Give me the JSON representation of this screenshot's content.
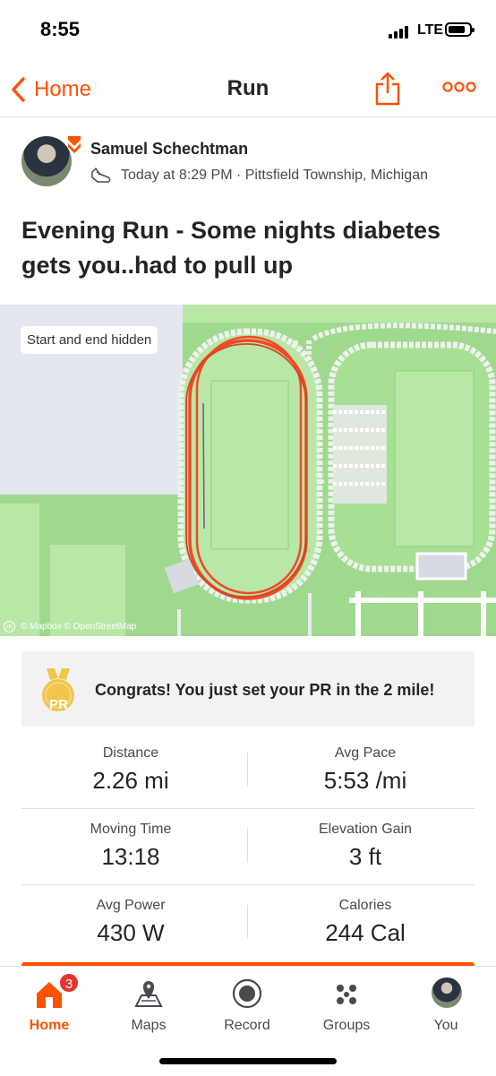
{
  "status_bar": {
    "time": "8:55",
    "network": "LTE"
  },
  "nav": {
    "back_label": "Home",
    "title": "Run"
  },
  "activity": {
    "athlete_name": "Samuel Schechtman",
    "meta": "Today at 8:29 PM · Pittsfield Township, Michigan",
    "title": "Evening Run - Some nights diabetes gets you..had to pull up"
  },
  "map": {
    "chip": "Start and end hidden",
    "attribution": "© Mapbox © OpenStreetMap"
  },
  "pr": {
    "badge": "PR",
    "message": "Congrats! You just set your PR in the 2 mile!"
  },
  "stats": [
    {
      "left_label": "Distance",
      "left_value": "2.26 mi",
      "right_label": "Avg Pace",
      "right_value": "5:53 /mi"
    },
    {
      "left_label": "Moving Time",
      "left_value": "13:18",
      "right_label": "Elevation Gain",
      "right_value": "3 ft"
    },
    {
      "left_label": "Avg Power",
      "left_value": "430 W",
      "right_label": "Calories",
      "right_value": "244 Cal"
    }
  ],
  "tabs": [
    {
      "label": "Home",
      "icon": "home-icon",
      "badge": "3",
      "active": true
    },
    {
      "label": "Maps",
      "icon": "map-pin-icon"
    },
    {
      "label": "Record",
      "icon": "record-icon"
    },
    {
      "label": "Groups",
      "icon": "groups-icon"
    },
    {
      "label": "You",
      "icon": "avatar"
    }
  ],
  "colors": {
    "accent": "#fc5200",
    "map_green": "#9fd98e",
    "route": "#ee4a24"
  }
}
